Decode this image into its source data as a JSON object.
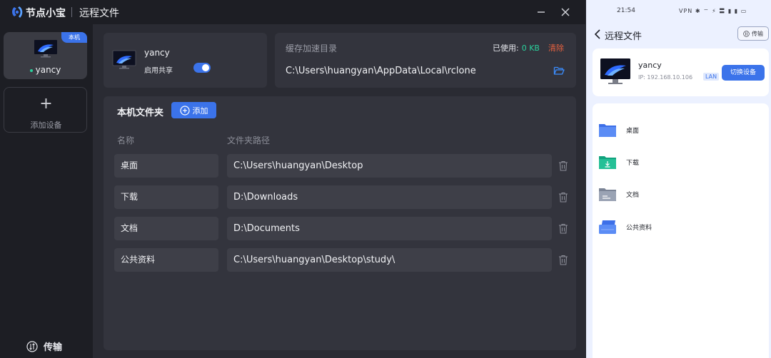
{
  "app": {
    "name": "节点小宝",
    "page_title": "远程文件"
  },
  "sidebar": {
    "device": {
      "name": "yancy",
      "badge": "本机"
    },
    "add_device_label": "添加设备",
    "transfer_label": "传输"
  },
  "share": {
    "name": "yancy",
    "label": "启用共享",
    "enabled": true
  },
  "cache": {
    "title": "缓存加速目录",
    "used_label": "已使用:",
    "used_value": "0 KB",
    "clear_label": "清除",
    "path": "C:\\Users\\huangyan\\AppData\\Local\\rclone"
  },
  "folders": {
    "title": "本机文件夹",
    "add_label": "添加",
    "col_name": "名称",
    "col_path": "文件夹路径",
    "rows": [
      {
        "name": "桌面",
        "path": "C:\\Users\\huangyan\\Desktop"
      },
      {
        "name": "下载",
        "path": "D:\\Downloads"
      },
      {
        "name": "文档",
        "path": "D:\\Documents"
      },
      {
        "name": "公共资料",
        "path": "C:\\Users\\huangyan\\Desktop\\study\\"
      }
    ]
  },
  "phone": {
    "status_time": "21:54",
    "status_icons": "VPN ✱ ⌔ ⚡ 〓 ▮ ▮ ▭",
    "title": "远程文件",
    "transfer_label": "传输",
    "device_name": "yancy",
    "device_ip": "IP: 192.168.10.106",
    "device_lan": "LAN",
    "switch_label": "切换设备",
    "items": [
      {
        "label": "桌面",
        "icon": "folder-blue-icon"
      },
      {
        "label": "下载",
        "icon": "folder-download-icon"
      },
      {
        "label": "文档",
        "icon": "folder-docs-icon"
      },
      {
        "label": "公共资料",
        "icon": "folder-shared-icon"
      }
    ]
  },
  "colors": {
    "accent": "#3b73ea",
    "online": "#2ad19c",
    "danger": "#e5613f",
    "panel": "#33343d"
  }
}
